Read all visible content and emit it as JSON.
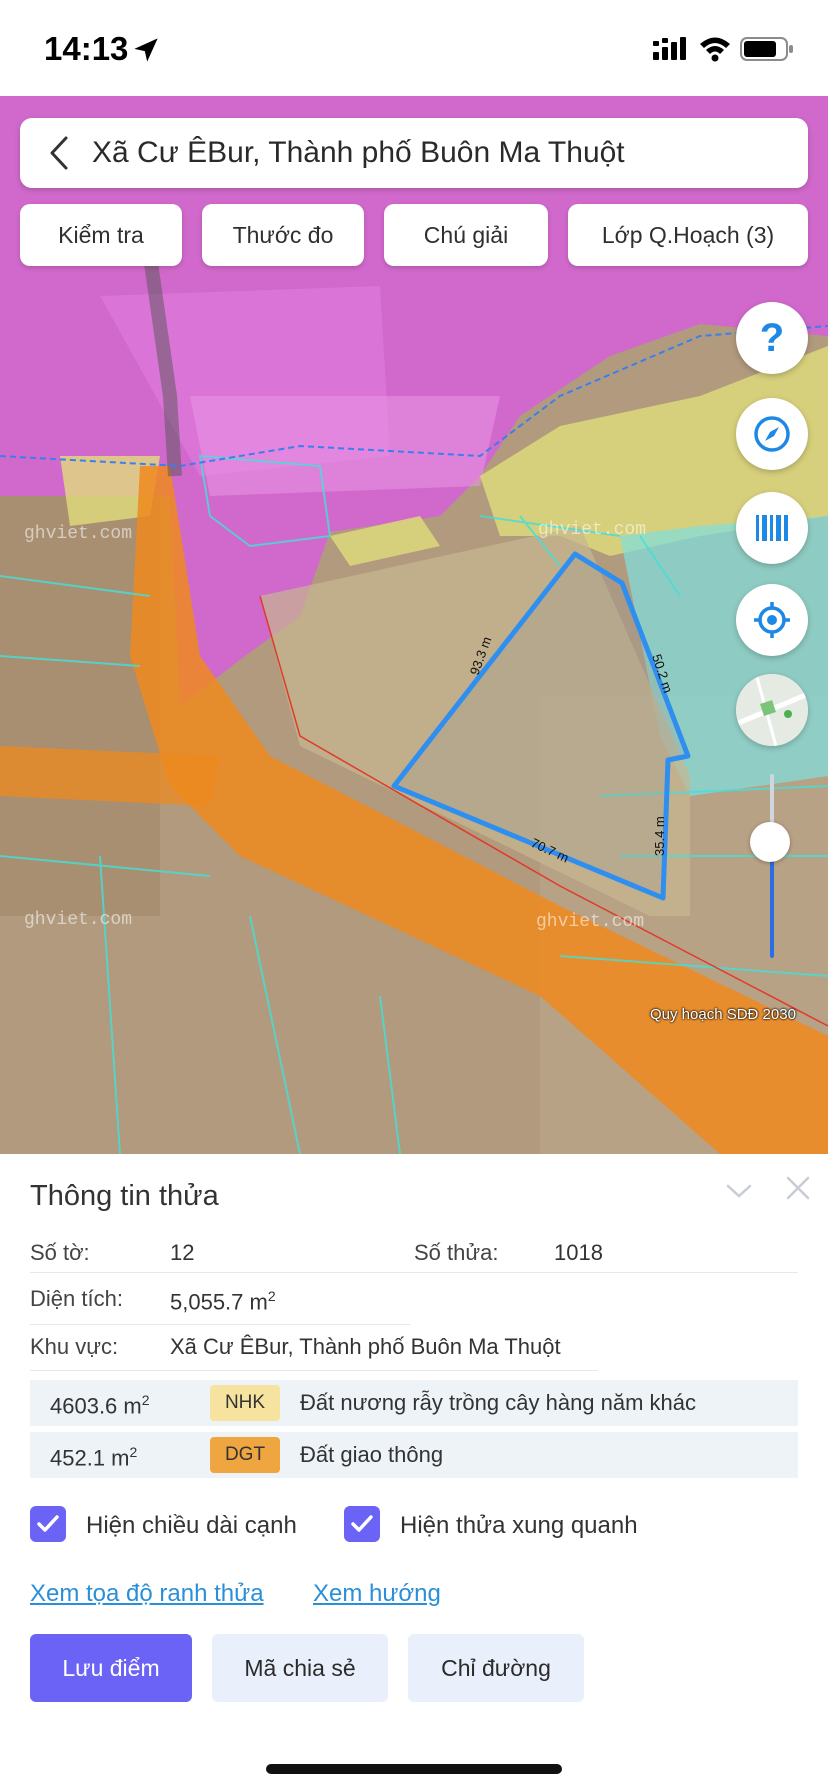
{
  "status_bar": {
    "time": "14:13",
    "icons": [
      "location-arrow-icon",
      "cellular-signal-icon",
      "wifi-icon",
      "battery-icon"
    ]
  },
  "map": {
    "search": {
      "title": "Xã Cư ÊBur, Thành phố Buôn Ma Thuột"
    },
    "chips": [
      {
        "label": "Kiểm tra"
      },
      {
        "label": "Thước đo"
      },
      {
        "label": "Chú giải"
      },
      {
        "label": "Lớp Q.Hoạch (3)"
      }
    ],
    "fab": {
      "help": "?"
    },
    "watermarks": [
      "ghviet.com",
      "ghviet.com",
      "ghviet.com",
      "ghviet.com"
    ],
    "edge_lengths": [
      "93.3 m",
      "50.2 m",
      "70.7 m",
      "35.4 m"
    ],
    "layer_label": "Quy hoạch SDĐ 2030",
    "zoom_level": 0.62,
    "colors": {
      "residential_pink": "#d660d8",
      "orange_road": "#ee8a1f",
      "yellow_zone": "#e6e07a",
      "cyan_zone": "#7fe0e0",
      "parcel_outline": "#2f8ff0"
    }
  },
  "panel": {
    "title": "Thông tin thửa",
    "so_to": {
      "label": "Số tờ:",
      "value": "12"
    },
    "so_thua": {
      "label": "Số thửa:",
      "value": "1018"
    },
    "dien_tich": {
      "label": "Diện tích:",
      "value": "5,055.7 m",
      "unit_sup": "2"
    },
    "khu_vuc": {
      "label": "Khu vực:",
      "value": "Xã Cư ÊBur, Thành phố Buôn Ma Thuột"
    },
    "land_uses": [
      {
        "area": "4603.6 m",
        "sup": "2",
        "code": "NHK",
        "code_color": "#f6e3a0",
        "desc": "Đất nương rẫy trồng cây hàng năm khác"
      },
      {
        "area": "452.1 m",
        "sup": "2",
        "code": "DGT",
        "code_color": "#f0a640",
        "desc": "Đất giao thông"
      }
    ],
    "options": [
      {
        "label": "Hiện chiều dài cạnh",
        "checked": true
      },
      {
        "label": "Hiện thửa xung quanh",
        "checked": true
      }
    ],
    "links": [
      {
        "label": "Xem tọa độ ranh thửa"
      },
      {
        "label": "Xem hướng"
      }
    ],
    "buttons": [
      {
        "label": "Lưu điểm"
      },
      {
        "label": "Mã chia sẻ"
      },
      {
        "label": "Chỉ đường"
      }
    ]
  }
}
